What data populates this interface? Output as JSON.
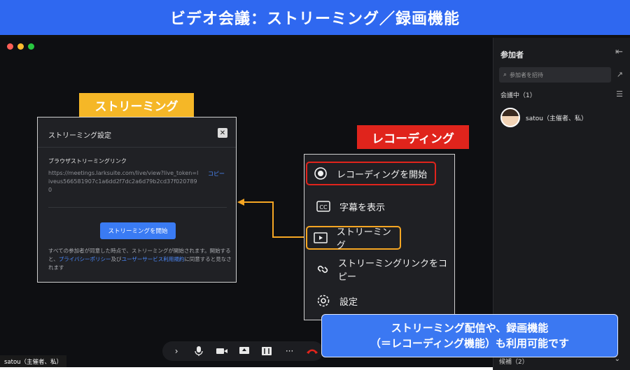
{
  "banner": {
    "title": "ビデオ会議：ストリーミング／録画機能"
  },
  "sidebar": {
    "title": "参加者",
    "search_placeholder": "参加者を招待",
    "in_meeting": "会議中（1）",
    "user_name": "satou（主催者、私）",
    "candidates": "候補（2）"
  },
  "stream_tag": "ストリーミング",
  "dialog": {
    "title": "ストリーミング設定",
    "label": "ブラウザストリーミングリンク",
    "link": "https://meetings.larksuite.com/live/view?live_token=liveus566581907c1a6dd2f7dc2a6d79b2cd37f0207890",
    "copy": "コピー",
    "start_button": "ストリーミングを開始",
    "note_1": "すべての参加者が同意した時点で、ストリーミングが開始されます。開始すると、",
    "privacy": "プライバシーポリシー",
    "and": "及び",
    "terms": "ユーザーサービス利用規約",
    "note_2": "に同意すると見なされます"
  },
  "rec_tag": "レコーディング",
  "menu": {
    "items": [
      {
        "label": "レコーディングを開始",
        "icon": "record-icon"
      },
      {
        "label": "字幕を表示",
        "icon": "cc-icon"
      },
      {
        "label": "ストリーミング",
        "icon": "stream-icon"
      },
      {
        "label": "ストリーミングリンクをコピー",
        "icon": "link-icon"
      },
      {
        "label": "設定",
        "icon": "gear-icon"
      }
    ]
  },
  "bottom_message": {
    "line1": "ストリーミング配信や、録画機能",
    "line2": "（＝レコーディング機能）も利用可能です"
  },
  "user_label": "satou（主催者、私）",
  "colors": {
    "banner": "#2f68f0",
    "stream_tag": "#f5b727",
    "rec_tag": "#e0241c",
    "accent": "#3a7bf3"
  }
}
